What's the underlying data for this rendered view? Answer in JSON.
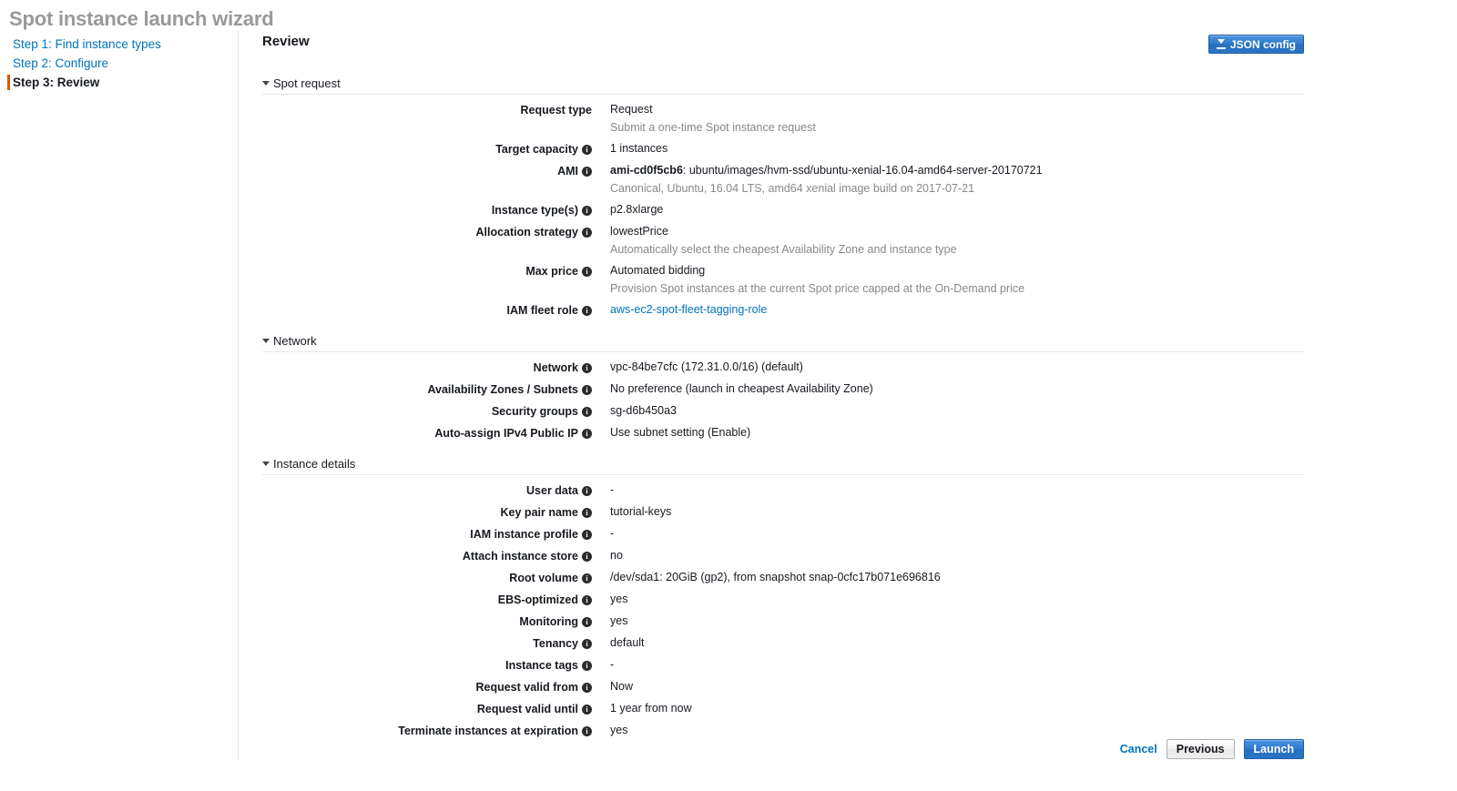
{
  "wizard": {
    "title": "Spot instance launch wizard",
    "steps": [
      {
        "label": "Step 1: Find instance types",
        "current": false
      },
      {
        "label": "Step 2: Configure",
        "current": false
      },
      {
        "label": "Step 3: Review",
        "current": true
      }
    ]
  },
  "panel": {
    "title": "Review",
    "json_config_label": "JSON config"
  },
  "sections": [
    {
      "name": "spot-request",
      "title": "Spot request",
      "rows": [
        {
          "label": "Request type",
          "info": false,
          "value": "Request",
          "sub": "Submit a one-time Spot instance request"
        },
        {
          "label": "Target capacity",
          "info": true,
          "value": "1 instances"
        },
        {
          "label": "AMI",
          "info": true,
          "value_strong": "ami-cd0f5cb6",
          "value": ": ubuntu/images/hvm-ssd/ubuntu-xenial-16.04-amd64-server-20170721",
          "sub": "Canonical, Ubuntu, 16.04 LTS, amd64 xenial image build on 2017-07-21"
        },
        {
          "label": "Instance type(s)",
          "info": true,
          "value": "p2.8xlarge"
        },
        {
          "label": "Allocation strategy",
          "info": true,
          "value": "lowestPrice",
          "sub": "Automatically select the cheapest Availability Zone and instance type"
        },
        {
          "label": "Max price",
          "info": true,
          "value": "Automated bidding",
          "sub": "Provision Spot instances at the current Spot price capped at the On-Demand price"
        },
        {
          "label": "IAM fleet role",
          "info": true,
          "link": "aws-ec2-spot-fleet-tagging-role"
        }
      ]
    },
    {
      "name": "network",
      "title": "Network",
      "rows": [
        {
          "label": "Network",
          "info": true,
          "value": "vpc-84be7cfc (172.31.0.0/16) (default)"
        },
        {
          "label": "Availability Zones / Subnets",
          "info": true,
          "value": "No preference (launch in cheapest Availability Zone)"
        },
        {
          "label": "Security groups",
          "info": true,
          "value": "sg-d6b450a3"
        },
        {
          "label": "Auto-assign IPv4 Public IP",
          "info": true,
          "value": "Use subnet setting (Enable)"
        }
      ]
    },
    {
      "name": "instance-details",
      "title": "Instance details",
      "rows": [
        {
          "label": "User data",
          "info": true,
          "value": "-"
        },
        {
          "label": "Key pair name",
          "info": true,
          "value": "tutorial-keys"
        },
        {
          "label": "IAM instance profile",
          "info": true,
          "value": "-"
        },
        {
          "label": "Attach instance store",
          "info": true,
          "value": "no"
        },
        {
          "label": "Root volume",
          "info": true,
          "value": "/dev/sda1: 20GiB (gp2), from snapshot snap-0cfc17b071e696816"
        },
        {
          "label": "EBS-optimized",
          "info": true,
          "value": "yes"
        },
        {
          "label": "Monitoring",
          "info": true,
          "value": "yes"
        },
        {
          "label": "Tenancy",
          "info": true,
          "value": "default"
        },
        {
          "label": "Instance tags",
          "info": true,
          "value": "-"
        },
        {
          "label": "Request valid from",
          "info": true,
          "value": "Now"
        },
        {
          "label": "Request valid until",
          "info": true,
          "value": "1 year from now"
        },
        {
          "label": "Terminate instances at expiration",
          "info": true,
          "value": "yes"
        }
      ]
    }
  ],
  "footer": {
    "cancel_label": "Cancel",
    "previous_label": "Previous",
    "launch_label": "Launch"
  },
  "icons": {
    "info": "i",
    "download": "download-icon",
    "caret": "caret-down-icon"
  },
  "colors": {
    "link": "#0073bb",
    "primary_button": "#2670c0",
    "step_marker": "#d45b07",
    "title_gray": "#999999",
    "sub_text": "#888888"
  }
}
